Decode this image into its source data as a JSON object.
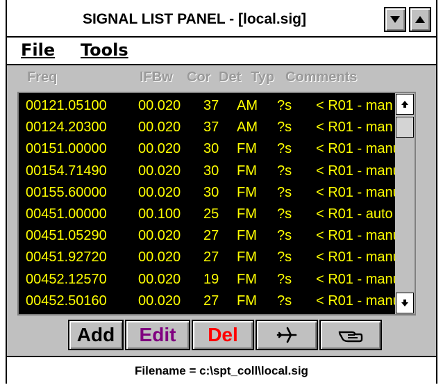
{
  "window": {
    "title": "SIGNAL LIST PANEL - [local.sig]"
  },
  "menu": {
    "file_label": "File",
    "tools_label": "Tools"
  },
  "columns": [
    "Freq",
    "IFBw",
    "Cor",
    "Det",
    "Typ",
    "Comments"
  ],
  "rows": [
    {
      "freq": "00121.05100",
      "ifbw": "00.020",
      "cor": "37",
      "det": "AM",
      "typ": "?s",
      "comments": "< R01 - man"
    },
    {
      "freq": "00124.20300",
      "ifbw": "00.020",
      "cor": "37",
      "det": "AM",
      "typ": "?s",
      "comments": "< R01 - man"
    },
    {
      "freq": "00151.00000",
      "ifbw": "00.020",
      "cor": "30",
      "det": "FM",
      "typ": "?s",
      "comments": "< R01 - manu"
    },
    {
      "freq": "00154.71490",
      "ifbw": "00.020",
      "cor": "30",
      "det": "FM",
      "typ": "?s",
      "comments": "< R01 - manu"
    },
    {
      "freq": "00155.60000",
      "ifbw": "00.020",
      "cor": "30",
      "det": "FM",
      "typ": "?s",
      "comments": "< R01 - manu"
    },
    {
      "freq": "00451.00000",
      "ifbw": "00.100",
      "cor": "25",
      "det": "FM",
      "typ": "?s",
      "comments": "< R01 - auto"
    },
    {
      "freq": "00451.05290",
      "ifbw": "00.020",
      "cor": "27",
      "det": "FM",
      "typ": "?s",
      "comments": "< R01 - manu"
    },
    {
      "freq": "00451.92720",
      "ifbw": "00.020",
      "cor": "27",
      "det": "FM",
      "typ": "?s",
      "comments": "< R01 - manu"
    },
    {
      "freq": "00452.12570",
      "ifbw": "00.020",
      "cor": "19",
      "det": "FM",
      "typ": "?s",
      "comments": "< R01 - manu"
    },
    {
      "freq": "00452.50160",
      "ifbw": "00.020",
      "cor": "27",
      "det": "FM",
      "typ": "?s",
      "comments": "< R01 - manu"
    }
  ],
  "buttons": {
    "add_label": "Add",
    "edit_label": "Edit",
    "del_label": "Del",
    "plane_icon": "airplane-icon",
    "hand_icon": "pointing-hand-icon"
  },
  "colors": {
    "list_bg": "#000000",
    "list_text": "#ffff00",
    "edit_color": "#800080",
    "del_color": "#ff0000"
  },
  "status": {
    "filename": "Filename = c:\\spt_coll\\local.sig"
  }
}
